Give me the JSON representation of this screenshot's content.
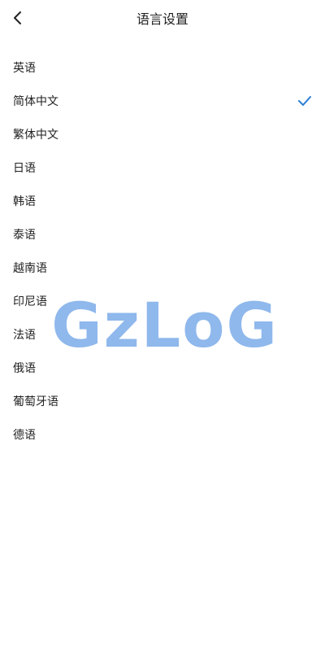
{
  "header": {
    "title": "语言设置",
    "back_icon": "chevron-left-icon"
  },
  "languages": [
    {
      "label": "英语",
      "selected": false
    },
    {
      "label": "简体中文",
      "selected": true
    },
    {
      "label": "繁体中文",
      "selected": false
    },
    {
      "label": "日语",
      "selected": false
    },
    {
      "label": "韩语",
      "selected": false
    },
    {
      "label": "泰语",
      "selected": false
    },
    {
      "label": "越南语",
      "selected": false
    },
    {
      "label": "印尼语",
      "selected": false
    },
    {
      "label": "法语",
      "selected": false
    },
    {
      "label": "俄语",
      "selected": false
    },
    {
      "label": "葡萄牙语",
      "selected": false
    },
    {
      "label": "德语",
      "selected": false
    }
  ],
  "watermark": "GzLoG",
  "colors": {
    "check": "#2a7fd4",
    "watermark": "#8fb8ec"
  }
}
